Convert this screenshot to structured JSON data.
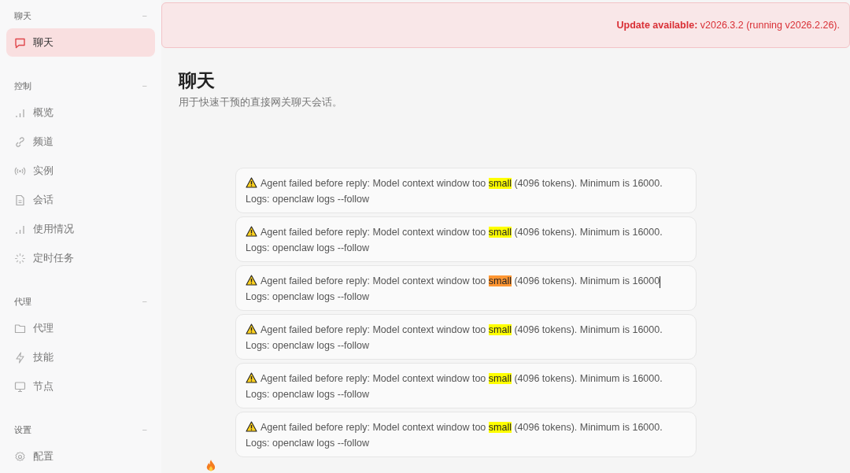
{
  "sidebar": {
    "groups": [
      {
        "heading": "聊天",
        "collapse": "−",
        "items": [
          {
            "label": "聊天",
            "selected": true
          }
        ]
      },
      {
        "heading": "控制",
        "collapse": "−",
        "items": [
          {
            "label": "概览",
            "selected": false
          },
          {
            "label": "频道",
            "selected": false
          },
          {
            "label": "实例",
            "selected": false
          },
          {
            "label": "会话",
            "selected": false
          },
          {
            "label": "使用情况",
            "selected": false
          },
          {
            "label": "定时任务",
            "selected": false
          }
        ]
      },
      {
        "heading": "代理",
        "collapse": "−",
        "items": [
          {
            "label": "代理",
            "selected": false
          },
          {
            "label": "技能",
            "selected": false
          },
          {
            "label": "节点",
            "selected": false
          }
        ]
      },
      {
        "heading": "设置",
        "collapse": "−",
        "items": [
          {
            "label": "配置",
            "selected": false
          }
        ]
      }
    ]
  },
  "banner": {
    "text": "**Update available:** v2026.3.2 (running v2026.2.26)."
  },
  "page": {
    "title": "聊天",
    "subtitle": "用于快速干预的直接网关聊天会话。"
  },
  "messages": [
    {
      "before": "Agent failed before reply: Model context window too ",
      "match": "small",
      "after": " (4096 tokens). Minimum is 16000.",
      "logs": "Logs: openclaw logs --follow",
      "current": false,
      "caret": false
    },
    {
      "before": "Agent failed before reply: Model context window too ",
      "match": "small",
      "after": " (4096 tokens). Minimum is 16000.",
      "logs": "Logs: openclaw logs --follow",
      "current": false,
      "caret": false
    },
    {
      "before": "Agent failed before reply: Model context window too ",
      "match": "small",
      "after": " (4096 tokens). Minimum is 16000",
      "logs": "Logs: openclaw logs --follow",
      "current": true,
      "caret": true
    },
    {
      "before": "Agent failed before reply: Model context window too ",
      "match": "small",
      "after": " (4096 tokens). Minimum is 16000.",
      "logs": "Logs: openclaw logs --follow",
      "current": false,
      "caret": false
    },
    {
      "before": "Agent failed before reply: Model context window too ",
      "match": "small",
      "after": " (4096 tokens). Minimum is 16000.",
      "logs": "Logs: openclaw logs --follow",
      "current": false,
      "caret": false
    },
    {
      "before": "Agent failed before reply: Model context window too ",
      "match": "small",
      "after": " (4096 tokens). Minimum is 16000.",
      "logs": "Logs: openclaw logs --follow",
      "current": false,
      "caret": false
    }
  ]
}
